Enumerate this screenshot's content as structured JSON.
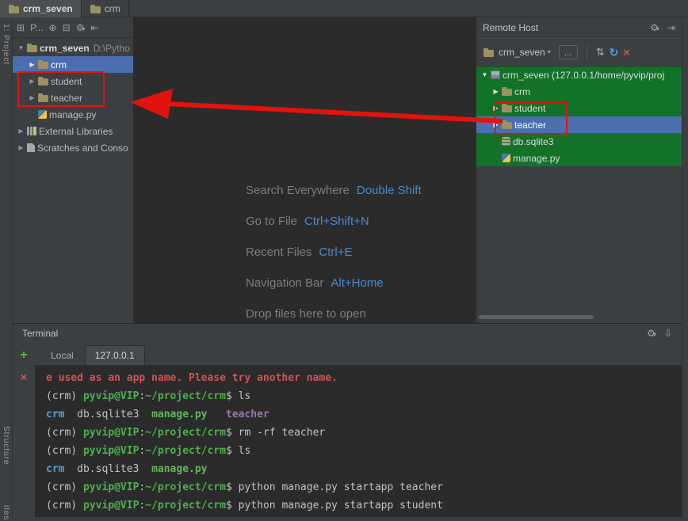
{
  "colors": {
    "panel_bg": "#3c3f41",
    "editor_bg": "#2b2b2b",
    "selection_blue": "#4b6eaf",
    "remote_green_row": "#12722a",
    "annotation_red": "#e0140c",
    "shortcut_blue": "#4a8ac9",
    "terminal_error_red": "#d25252",
    "terminal_prompt_green": "#4eae4e",
    "terminal_dir_blue": "#5c9bd6"
  },
  "icons": {
    "panel": "⊞",
    "locate": "⊕",
    "collapse": "⊟",
    "gear": "⚙",
    "dropdown": "▾",
    "hide_left": "⇤",
    "hide_right": "⇥",
    "hide_down": "⇩",
    "updown": "⇅",
    "sync": "↻",
    "close": "×",
    "plus": "+",
    "chevron_expanded": "▼",
    "chevron_collapsed": "▶"
  },
  "editor_tabs": [
    {
      "label": "crm_seven",
      "active": true
    },
    {
      "label": "crm",
      "active": false
    }
  ],
  "tool_stripes": {
    "left_top": "1: Project",
    "left_bottom1": "Structure",
    "left_bottom2": "ites"
  },
  "project_panel": {
    "toolbar": {
      "title": "P..."
    },
    "tree": [
      {
        "label": "crm_seven",
        "suffix": "D:\\Pytho",
        "icon": "folder",
        "depth": 0,
        "expanded": true,
        "bold": true
      },
      {
        "label": "crm",
        "icon": "folder",
        "depth": 1,
        "selected": true
      },
      {
        "label": "student",
        "icon": "folder",
        "depth": 1
      },
      {
        "label": "teacher",
        "icon": "folder",
        "depth": 1
      },
      {
        "label": "manage.py",
        "icon": "python",
        "depth": 1,
        "leaf": true
      },
      {
        "label": "External Libraries",
        "icon": "library",
        "depth": 0
      },
      {
        "label": "Scratches and Conso",
        "icon": "scratch",
        "depth": 0
      }
    ]
  },
  "editor_hints": [
    {
      "action": "Search Everywhere",
      "shortcut": "Double Shift"
    },
    {
      "action": "Go to File",
      "shortcut": "Ctrl+Shift+N"
    },
    {
      "action": "Recent Files",
      "shortcut": "Ctrl+E"
    },
    {
      "action": "Navigation Bar",
      "shortcut": "Alt+Home"
    },
    {
      "action": "Drop files here to open",
      "shortcut": ""
    }
  ],
  "remote_host": {
    "title": "Remote Host",
    "server": "crm_seven",
    "more": "...",
    "tree": [
      {
        "label": "crm_seven (127.0.0.1/home/pyvip/proj",
        "icon": "server",
        "depth": 0,
        "expanded": true,
        "green": true
      },
      {
        "label": "crm",
        "icon": "folder",
        "depth": 1,
        "green": true
      },
      {
        "label": "student",
        "icon": "folder",
        "depth": 1,
        "green": true
      },
      {
        "label": "teacher",
        "icon": "folder",
        "depth": 1,
        "selected": true
      },
      {
        "label": "db.sqlite3",
        "icon": "database",
        "depth": 1,
        "leaf": true,
        "green": true
      },
      {
        "label": "manage.py",
        "icon": "python",
        "depth": 1,
        "leaf": true,
        "green": true
      }
    ]
  },
  "terminal": {
    "title": "Terminal",
    "tabs": [
      {
        "label": "Local",
        "active": false
      },
      {
        "label": "127.0.0.1",
        "active": true
      }
    ],
    "lines": [
      {
        "segments": [
          {
            "text": "e used as an app name. Please try another name.",
            "style": "error"
          }
        ]
      },
      {
        "segments": [
          {
            "text": "(crm) ",
            "style": "plain"
          },
          {
            "text": "pyvip@VIP",
            "style": "prompt"
          },
          {
            "text": ":",
            "style": "plain"
          },
          {
            "text": "~/project/crm",
            "style": "path"
          },
          {
            "text": "$ ls",
            "style": "plain"
          }
        ]
      },
      {
        "segments": [
          {
            "text": "crm",
            "style": "dir"
          },
          {
            "text": "  db.sqlite3  ",
            "style": "plain"
          },
          {
            "text": "manage.py",
            "style": "exec"
          },
          {
            "text": "   ",
            "style": "plain"
          },
          {
            "text": "teacher",
            "style": "special"
          }
        ]
      },
      {
        "segments": [
          {
            "text": "(crm) ",
            "style": "plain"
          },
          {
            "text": "pyvip@VIP",
            "style": "prompt"
          },
          {
            "text": ":",
            "style": "plain"
          },
          {
            "text": "~/project/crm",
            "style": "path"
          },
          {
            "text": "$ rm -rf teacher",
            "style": "plain"
          }
        ]
      },
      {
        "segments": [
          {
            "text": "(crm) ",
            "style": "plain"
          },
          {
            "text": "pyvip@VIP",
            "style": "prompt"
          },
          {
            "text": ":",
            "style": "plain"
          },
          {
            "text": "~/project/crm",
            "style": "path"
          },
          {
            "text": "$ ls",
            "style": "plain"
          }
        ]
      },
      {
        "segments": [
          {
            "text": "crm",
            "style": "dir"
          },
          {
            "text": "  db.sqlite3  ",
            "style": "plain"
          },
          {
            "text": "manage.py",
            "style": "exec"
          }
        ]
      },
      {
        "segments": [
          {
            "text": "(crm) ",
            "style": "plain"
          },
          {
            "text": "pyvip@VIP",
            "style": "prompt"
          },
          {
            "text": ":",
            "style": "plain"
          },
          {
            "text": "~/project/crm",
            "style": "path"
          },
          {
            "text": "$ python manage.py startapp teacher",
            "style": "plain"
          }
        ]
      },
      {
        "segments": [
          {
            "text": "(crm) ",
            "style": "plain"
          },
          {
            "text": "pyvip@VIP",
            "style": "prompt"
          },
          {
            "text": ":",
            "style": "plain"
          },
          {
            "text": "~/project/crm",
            "style": "path"
          },
          {
            "text": "$ python manage.py startapp student",
            "style": "plain"
          }
        ]
      }
    ]
  }
}
